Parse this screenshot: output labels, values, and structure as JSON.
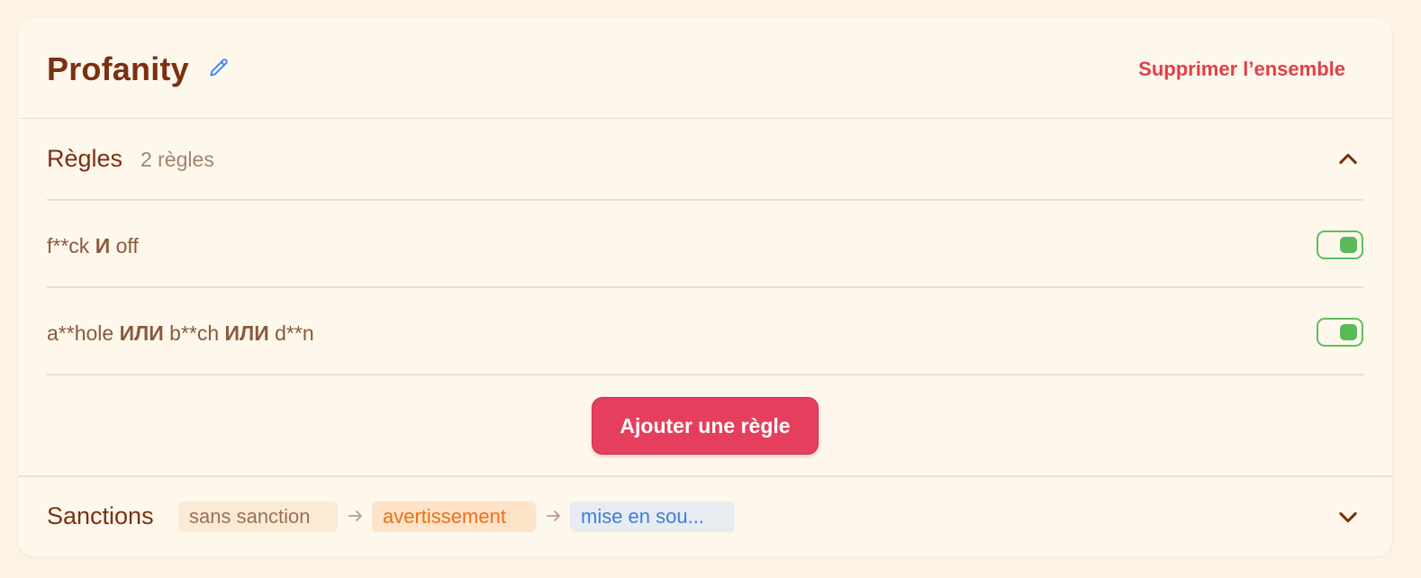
{
  "ruleset": {
    "title": "Profanity",
    "delete_label": "Supprimer l’ensemble"
  },
  "rules": {
    "title": "Règles",
    "count": "2 règles",
    "items": [
      {
        "parts": [
          {
            "t": "f**ck",
            "op": false
          },
          {
            "t": "И",
            "op": true
          },
          {
            "t": "off",
            "op": false
          }
        ],
        "enabled": true
      },
      {
        "parts": [
          {
            "t": "a**hole",
            "op": false
          },
          {
            "t": "ИЛИ",
            "op": true
          },
          {
            "t": "b**ch",
            "op": false
          },
          {
            "t": "ИЛИ",
            "op": true
          },
          {
            "t": "d**n",
            "op": false
          }
        ],
        "enabled": true
      }
    ],
    "add_label": "Ajouter une règle"
  },
  "sanctions": {
    "title": "Sanctions",
    "chips": [
      "sans sanction",
      "avertissement",
      "mise en sou..."
    ]
  },
  "colors": {
    "accent": "#e63f5d",
    "toggle_on": "#58bb58",
    "title": "#7a3011"
  },
  "icons": {
    "edit": "pencil-icon",
    "rules_toggle": "chevron-up-icon",
    "sanctions_toggle": "chevron-down-icon",
    "arrow": "arrow-right-icon"
  }
}
